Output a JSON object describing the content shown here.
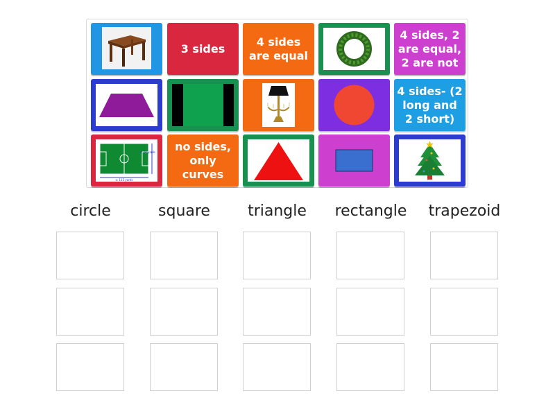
{
  "colors": {
    "blue": "#2196e3",
    "red": "#d8273e",
    "orange": "#f46a12",
    "green": "#189150",
    "magenta": "#cc3fcf",
    "purple": "#7d2ee0",
    "cyan": "#1e9fe4",
    "royal": "#2c3ccf"
  },
  "tiles": [
    {
      "type": "image",
      "icon": "table-icon",
      "bg": "blue"
    },
    {
      "type": "text",
      "text": "3 sides",
      "bg": "red"
    },
    {
      "type": "text",
      "text": "4 sides are equal",
      "bg": "orange"
    },
    {
      "type": "image",
      "icon": "wreath-icon",
      "bg": "green"
    },
    {
      "type": "text",
      "text": "4 sides, 2 are equal, 2 are not",
      "bg": "magenta"
    },
    {
      "type": "image",
      "icon": "trapezoid-shape",
      "bg": "royal"
    },
    {
      "type": "image",
      "icon": "green-square-shape",
      "bg": "green"
    },
    {
      "type": "image",
      "icon": "candelabra-lamp-icon",
      "bg": "orange"
    },
    {
      "type": "image",
      "icon": "red-circle-shape",
      "bg": "purple"
    },
    {
      "type": "text",
      "text": "4 sides- (2 long and 2 short)",
      "bg": "cyan"
    },
    {
      "type": "image",
      "icon": "soccer-field-icon",
      "bg": "red"
    },
    {
      "type": "text",
      "text": "no sides, only curves",
      "bg": "orange"
    },
    {
      "type": "image",
      "icon": "red-triangle-shape",
      "bg": "green"
    },
    {
      "type": "image",
      "icon": "blue-rectangle-shape",
      "bg": "magenta"
    },
    {
      "type": "image",
      "icon": "christmas-tree-icon",
      "bg": "royal"
    }
  ],
  "field_labels": {
    "side": "x: 74 yards",
    "bottom": "x: 115 yards"
  },
  "columns": [
    "circle",
    "square",
    "triangle",
    "rectangle",
    "trapezoid"
  ]
}
